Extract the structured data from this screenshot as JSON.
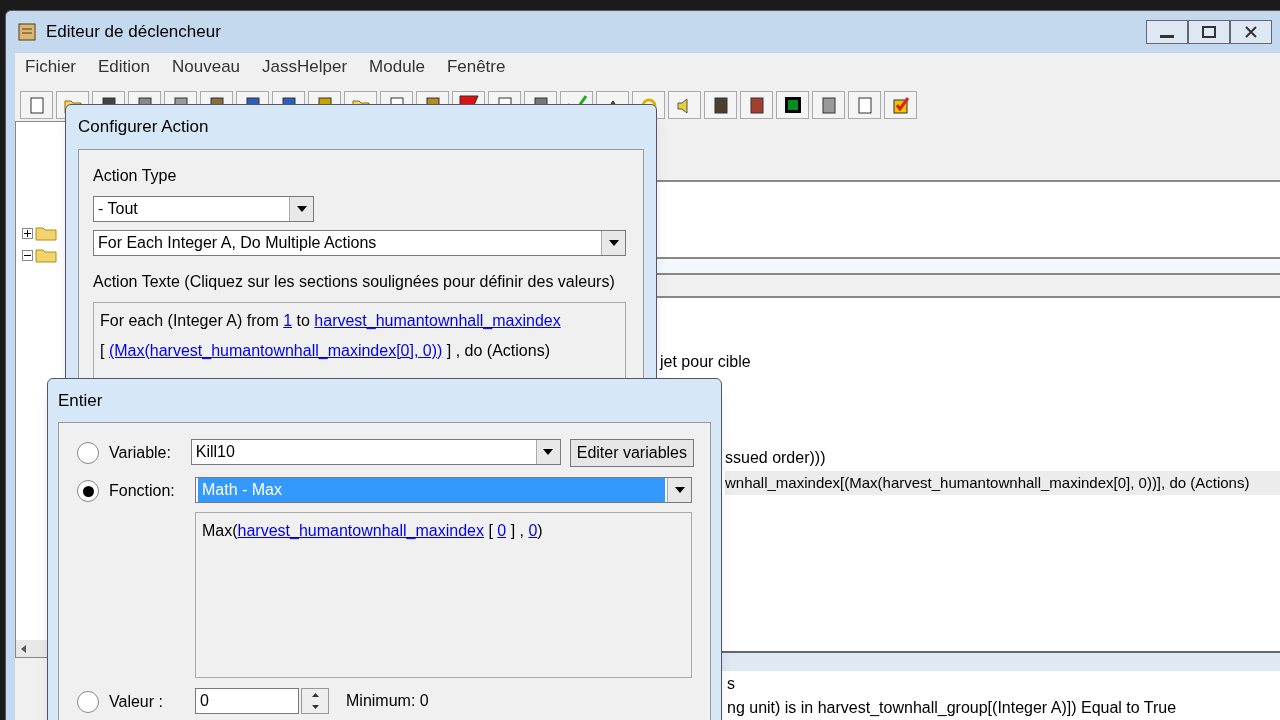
{
  "window": {
    "title": "Editeur de déclencheur"
  },
  "menu": [
    "Fichier",
    "Edition",
    "Nouveau",
    "JassHelper",
    "Module",
    "Fenêtre"
  ],
  "tree": [
    {
      "expanded": false
    },
    {
      "expanded": true
    }
  ],
  "main_lines": [
    {
      "text": "jet pour cible",
      "highlighted": false
    },
    {
      "text": "ssued order)))",
      "highlighted": false
    },
    {
      "text": "wnhall_maxindex[(Max(harvest_humantownhall_maxindex[0], 0))], do (Actions)",
      "highlighted": true
    }
  ],
  "bottom_lines": [
    "s",
    "ng unit) is in harvest_townhall_group[(Integer A)]) Equal to True"
  ],
  "configure_dialog": {
    "title": "Configurer Action",
    "action_type_label": "Action Type",
    "category": "- Tout",
    "action": "For Each Integer A, Do Multiple Actions",
    "text_label": "Action Texte (Cliquez sur les sections soulignées pour définir des valeurs)",
    "action_text_lines": [
      [
        {
          "text": "For each (Integer A) from ",
          "kind": "text"
        },
        {
          "text": "1",
          "kind": "link"
        },
        {
          "text": " to ",
          "kind": "text"
        },
        {
          "text": "harvest_humantownhall_maxindex",
          "kind": "link"
        }
      ],
      [
        {
          "text": "[ ",
          "kind": "text"
        },
        {
          "text": "(Max(harvest_humantownhall_maxindex[0], 0))",
          "kind": "link"
        },
        {
          "text": " ] , do (Actions)",
          "kind": "text"
        }
      ]
    ]
  },
  "entier_dialog": {
    "title": "Entier",
    "options": [
      {
        "kind": "variable",
        "label": "Variable:",
        "selected": false,
        "value": "Kill10"
      },
      {
        "kind": "function",
        "label": "Fonction:",
        "selected": true,
        "value": "Math - Max"
      },
      {
        "kind": "value",
        "label": "Valeur :",
        "selected": false,
        "value": "0"
      }
    ],
    "edit_button": "Editer variables",
    "function_text": [
      {
        "text": "Max(",
        "kind": "text"
      },
      {
        "text": "harvest_humantownhall_maxindex",
        "kind": "link"
      },
      {
        "text": " [ ",
        "kind": "text"
      },
      {
        "text": "0",
        "kind": "link"
      },
      {
        "text": " ] , ",
        "kind": "text"
      },
      {
        "text": "0",
        "kind": "link"
      },
      {
        "text": ")",
        "kind": "text"
      }
    ],
    "minimum": "Minimum: 0"
  }
}
